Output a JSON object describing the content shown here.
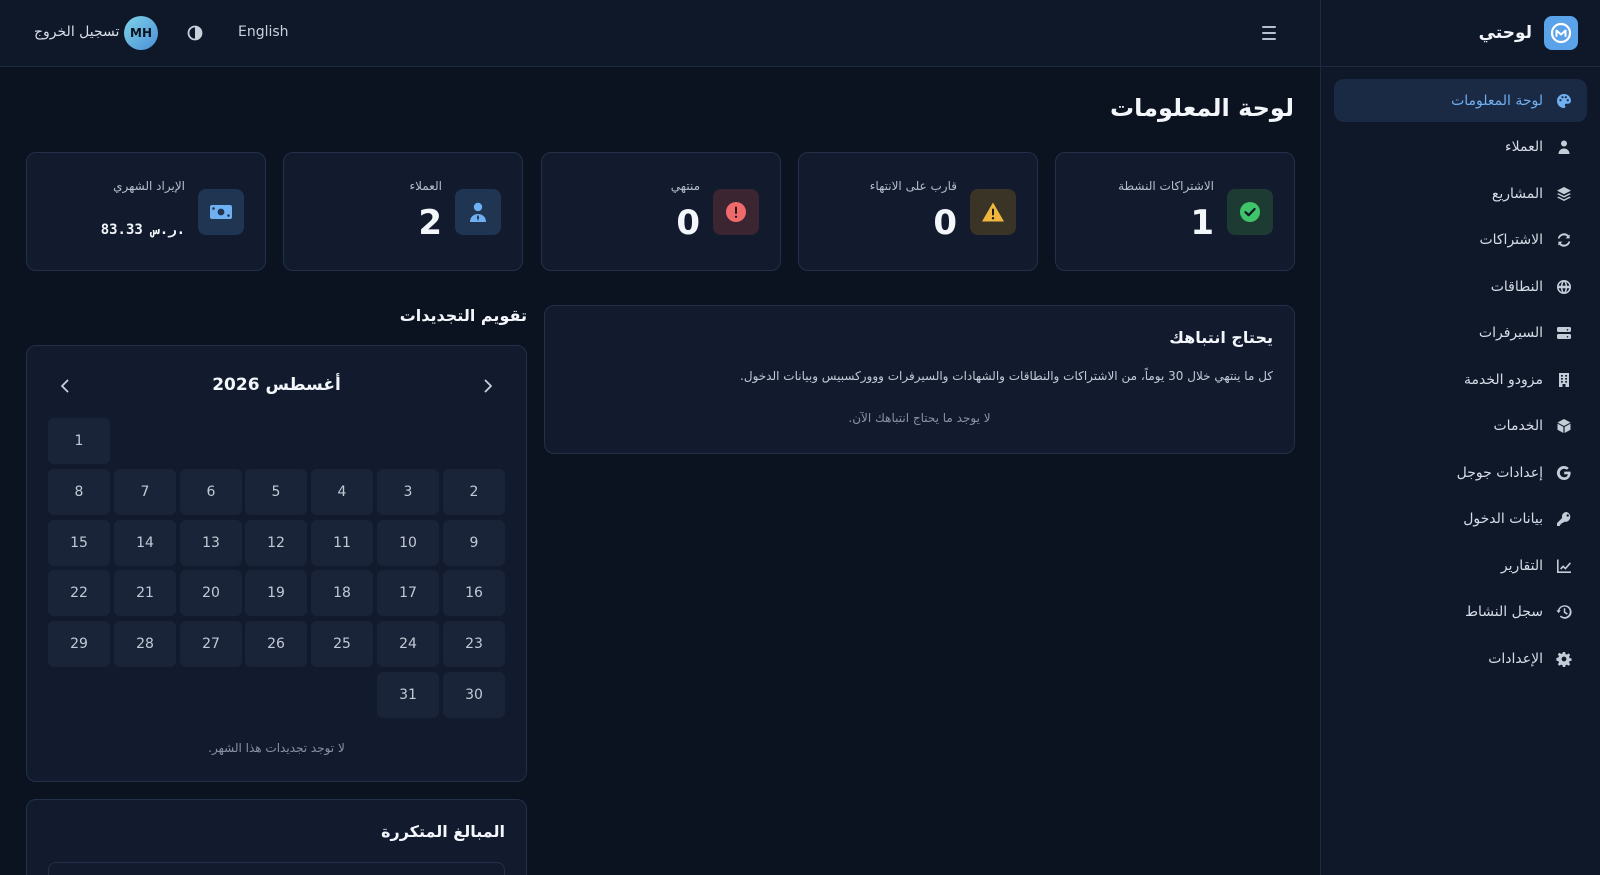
{
  "brand": {
    "name": "لوحتي"
  },
  "sidebar": {
    "items": [
      {
        "label": "لوحة المعلومات",
        "icon": "palette-icon",
        "active": true
      },
      {
        "label": "العملاء",
        "icon": "user-icon"
      },
      {
        "label": "المشاريع",
        "icon": "layers-icon"
      },
      {
        "label": "الاشتراكات",
        "icon": "refresh-icon"
      },
      {
        "label": "النطاقات",
        "icon": "globe-icon"
      },
      {
        "label": "السيرفرات",
        "icon": "server-icon"
      },
      {
        "label": "مزودو الخدمة",
        "icon": "building-icon"
      },
      {
        "label": "الخدمات",
        "icon": "cube-icon"
      },
      {
        "label": "إعدادات جوجل",
        "icon": "google-icon"
      },
      {
        "label": "بيانات الدخول",
        "icon": "key-icon"
      },
      {
        "label": "التقارير",
        "icon": "chart-line-icon"
      },
      {
        "label": "سجل النشاط",
        "icon": "history-icon"
      },
      {
        "label": "الإعدادات",
        "icon": "gear-icon"
      }
    ]
  },
  "topbar": {
    "language": "English",
    "avatar_initials": "MH",
    "logout": "تسجيل الخروج"
  },
  "page": {
    "title": "لوحة المعلومات"
  },
  "stats": [
    {
      "label": "الاشتراكات النشطة",
      "value": "1",
      "icon": "check-circle-icon",
      "color": "#3fc46a"
    },
    {
      "label": "قارب على الانتهاء",
      "value": "0",
      "icon": "warning-icon",
      "color": "#f1b63d"
    },
    {
      "label": "منتهي",
      "value": "0",
      "icon": "alert-circle-icon",
      "color": "#ef6b6b"
    },
    {
      "label": "العملاء",
      "value": "2",
      "icon": "user-icon",
      "color": "#6fb0f2"
    },
    {
      "label": "الإيراد الشهري",
      "value": "83.33 ر.س.",
      "icon": "money-icon",
      "color": "#6fb0f2"
    }
  ],
  "attention": {
    "title": "يحتاج انتباهك",
    "description": "كل ما ينتهي خلال 30 يوماً، من الاشتراكات والنطاقات والشهادات والسيرفرات وووركسبيس وبيانات الدخول.",
    "empty": "لا يوجد ما يحتاج انتباهك الآن."
  },
  "calendar": {
    "title": "تقويم التجديدات",
    "month": "أغسطس 2026",
    "days": [
      "1",
      "2",
      "3",
      "4",
      "5",
      "6",
      "7",
      "8",
      "9",
      "10",
      "11",
      "12",
      "13",
      "14",
      "15",
      "16",
      "17",
      "18",
      "19",
      "20",
      "21",
      "22",
      "23",
      "24",
      "25",
      "26",
      "27",
      "28",
      "29",
      "30",
      "31"
    ],
    "empty": "لا توجد تجديدات هذا الشهر."
  },
  "recurring": {
    "title": "المبالغ المتكررة"
  }
}
